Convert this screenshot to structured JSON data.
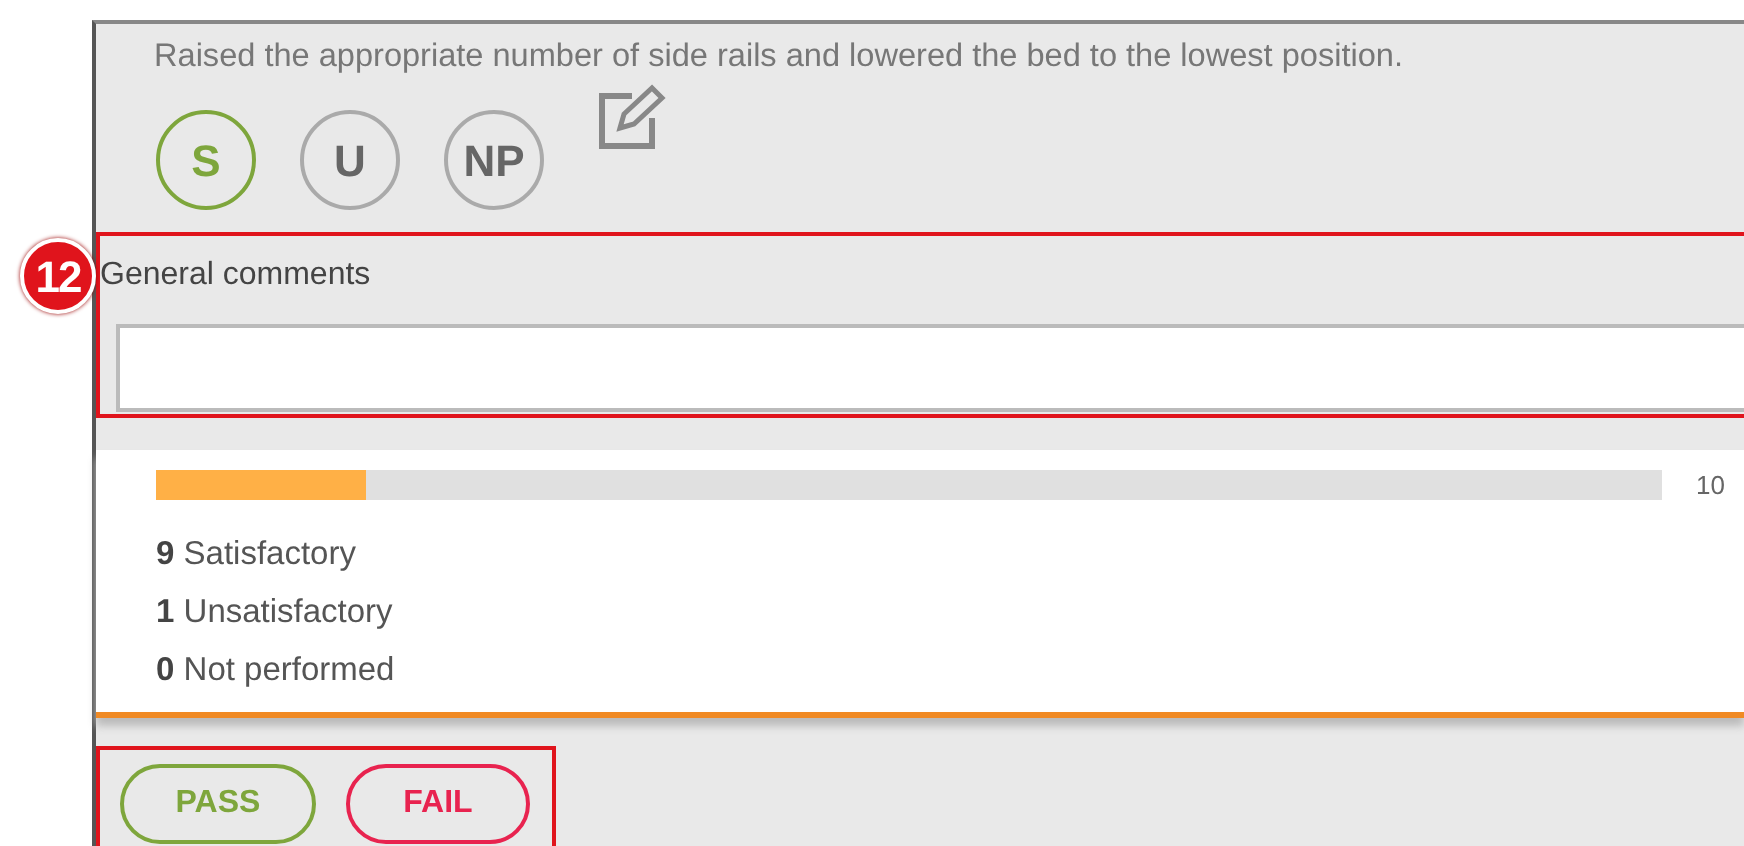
{
  "item": {
    "text": "Raised the appropriate number of side rails and lowered the bed to the lowest position.",
    "ratings": [
      {
        "label": "S",
        "selected": true
      },
      {
        "label": "U",
        "selected": false
      },
      {
        "label": "NP",
        "selected": false
      }
    ]
  },
  "comments": {
    "callout": "12",
    "label": "General comments"
  },
  "progress": {
    "level": 0.14,
    "reading": "10"
  },
  "counts": [
    {
      "count": "9",
      "label": "Satisfactory"
    },
    {
      "count": "1",
      "label": "Unsatisfactory"
    },
    {
      "count": "0",
      "label": "Not performed"
    }
  ],
  "decision": {
    "buttons": [
      {
        "label": "PASS",
        "kind": "pass"
      },
      {
        "label": "FAIL",
        "kind": "fail"
      }
    ]
  }
}
